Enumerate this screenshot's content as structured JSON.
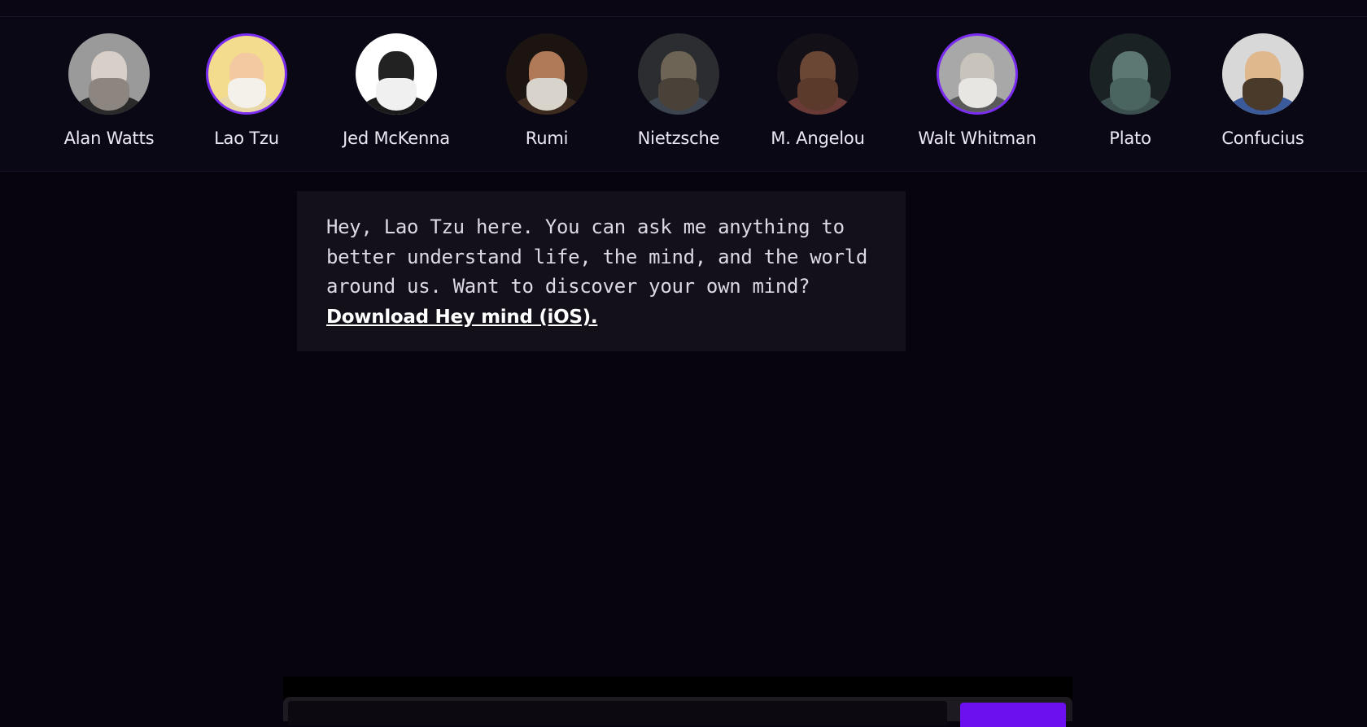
{
  "colors": {
    "background": "#07030f",
    "accent": "#7a2cf0",
    "send_button": "#6d10f0",
    "message_bg": "#131019"
  },
  "personas": [
    {
      "name": "Alan Watts",
      "active": false,
      "avatar": {
        "bg": "#9a9a9a",
        "face": "#d8d0c8",
        "beard": "#8d8680",
        "body": "#2a2a2a"
      }
    },
    {
      "name": "Lao Tzu",
      "active": true,
      "avatar": {
        "bg": "#f3dc8e",
        "face": "#f2c9a0",
        "beard": "#f4f1ea",
        "body": "#e8d8a8"
      }
    },
    {
      "name": "Jed McKenna",
      "active": false,
      "avatar": {
        "bg": "#ffffff",
        "face": "#222222",
        "beard": "#f0f0f0",
        "body": "#1a1a1a"
      }
    },
    {
      "name": "Rumi",
      "active": false,
      "avatar": {
        "bg": "#1c1410",
        "face": "#b07a58",
        "beard": "#d8d4cc",
        "body": "#3d2a1e"
      }
    },
    {
      "name": "Nietzsche",
      "active": false,
      "avatar": {
        "bg": "#2b2d30",
        "face": "#6d6455",
        "beard": "#4a4238",
        "body": "#3c4450"
      }
    },
    {
      "name": "M. Angelou",
      "active": false,
      "avatar": {
        "bg": "#141018",
        "face": "#6a4634",
        "beard": "#5b3a2c",
        "body": "#6a3a36"
      }
    },
    {
      "name": "Walt Whitman",
      "active": true,
      "avatar": {
        "bg": "#a8a8a8",
        "face": "#c8c4bc",
        "beard": "#e8e6e2",
        "body": "#5a5a5a"
      }
    },
    {
      "name": "Plato",
      "active": false,
      "avatar": {
        "bg": "#1a2224",
        "face": "#5d7772",
        "beard": "#4a6460",
        "body": "#3c5050"
      }
    },
    {
      "name": "Confucius",
      "active": false,
      "avatar": {
        "bg": "#d8d8d8",
        "face": "#e0b88e",
        "beard": "#4a3a2a",
        "body": "#3a5a9a"
      }
    }
  ],
  "message": {
    "text": "Hey, Lao Tzu here. You can ask me anything to better understand life, the mind, and the world around us. Want to discover your own mind? ",
    "link_text": "Download Hey mind (iOS)."
  }
}
